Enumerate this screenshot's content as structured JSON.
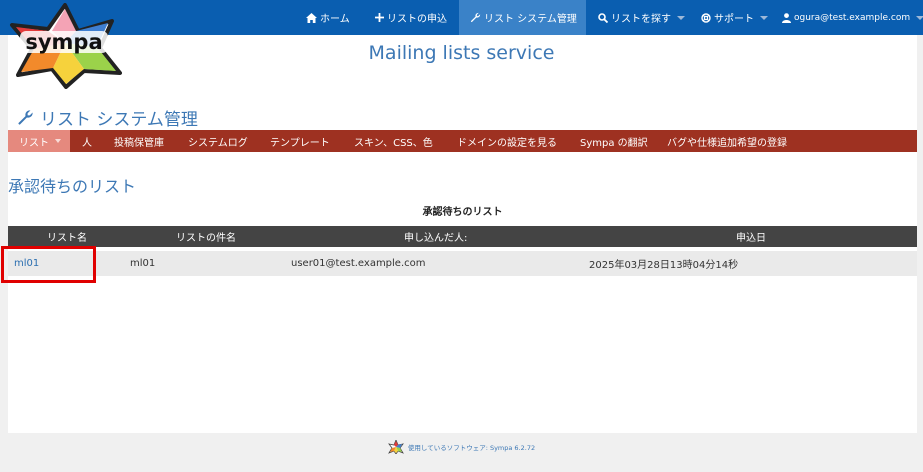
{
  "nav": {
    "home": "ホーム",
    "request_list": "リストの申込",
    "list_admin": "リスト システム管理",
    "find_list": "リストを探す",
    "support": "サポート",
    "user": "ogura@test.example.com"
  },
  "header": {
    "logo_text": "sympa",
    "service_title": "Mailing lists service"
  },
  "admin": {
    "title": "リスト システム管理",
    "menu": [
      "リスト",
      "人",
      "投稿保管庫",
      "システムログ",
      "テンプレート",
      "スキン、CSS、色",
      "ドメインの設定を見る",
      "Sympa の翻訳",
      "バグや仕様追加希望の登録"
    ]
  },
  "main": {
    "heading": "承認待ちのリスト",
    "caption": "承認待ちのリスト",
    "columns": [
      "リスト名",
      "リストの件名",
      "申し込んだ人:",
      "申込日"
    ],
    "rows": [
      {
        "name": "ml01",
        "subject": "ml01",
        "requester": "user01@test.example.com",
        "date": "2025年03月28日13時04分14秒"
      }
    ]
  },
  "footer": {
    "text": "使用しているソフトウェア: Sympa 6.2.72"
  },
  "colors": {
    "topnav": "#0a5eb0",
    "topnav_active": "#3a82c8",
    "adminmenu": "#9e3121",
    "adminmenu_active": "#e5897e",
    "table_header": "#444444",
    "accent_text": "#3d78b5",
    "highlight": "#e00000"
  }
}
